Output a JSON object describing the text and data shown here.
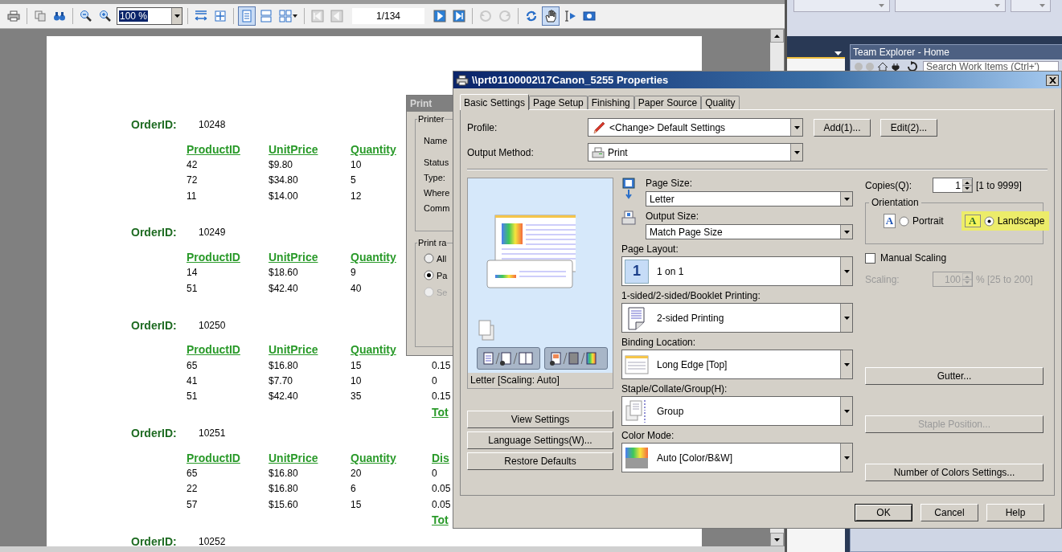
{
  "report_viewer": {
    "toolbar": [
      {
        "kind": "print",
        "pressed": false,
        "disabled": false
      },
      {
        "kind": "sep"
      },
      {
        "kind": "copy",
        "pressed": false,
        "disabled": false
      },
      {
        "kind": "find",
        "pressed": false,
        "disabled": false
      },
      {
        "kind": "sep"
      },
      {
        "kind": "zoom_out",
        "pressed": false,
        "disabled": false
      },
      {
        "kind": "zoom_in",
        "pressed": false,
        "disabled": false
      },
      {
        "kind": "zoom_field",
        "value": "100 %"
      },
      {
        "kind": "sep"
      },
      {
        "kind": "page_width",
        "pressed": false,
        "disabled": false
      },
      {
        "kind": "whole_page",
        "pressed": false,
        "disabled": false
      },
      {
        "kind": "sep"
      },
      {
        "kind": "single_page",
        "pressed": true,
        "disabled": false
      },
      {
        "kind": "continuous",
        "pressed": false,
        "disabled": false
      },
      {
        "kind": "multi_page",
        "pressed": false,
        "disabled": false
      },
      {
        "kind": "sep"
      },
      {
        "kind": "first",
        "pressed": false,
        "disabled": true
      },
      {
        "kind": "prev",
        "pressed": false,
        "disabled": true
      },
      {
        "kind": "page_field",
        "value": "1/134"
      },
      {
        "kind": "next",
        "pressed": false,
        "disabled": false
      },
      {
        "kind": "last",
        "pressed": false,
        "disabled": false
      },
      {
        "kind": "sep"
      },
      {
        "kind": "back",
        "pressed": false,
        "disabled": true
      },
      {
        "kind": "forward",
        "pressed": false,
        "disabled": true
      },
      {
        "kind": "sep"
      },
      {
        "kind": "refresh",
        "pressed": false,
        "disabled": false
      },
      {
        "kind": "hand",
        "pressed": true,
        "disabled": false
      },
      {
        "kind": "select",
        "pressed": false,
        "disabled": false
      },
      {
        "kind": "snapshot",
        "pressed": false,
        "disabled": false
      }
    ],
    "orders": [
      {
        "label": "OrderID:",
        "id": "10248",
        "headers": [
          "ProductID",
          "UnitPrice",
          "Quantity"
        ],
        "rows": [
          [
            "42",
            "$9.80",
            "10"
          ],
          [
            "72",
            "$34.80",
            "5"
          ],
          [
            "11",
            "$14.00",
            "12"
          ]
        ]
      },
      {
        "label": "OrderID:",
        "id": "10249",
        "headers": [
          "ProductID",
          "UnitPrice",
          "Quantity"
        ],
        "rows": [
          [
            "14",
            "$18.60",
            "9"
          ],
          [
            "51",
            "$42.40",
            "40"
          ]
        ]
      },
      {
        "label": "OrderID:",
        "id": "10250",
        "headers": [
          "ProductID",
          "UnitPrice",
          "Quantity"
        ],
        "rows": [
          [
            "65",
            "$16.80",
            "15",
            "0.15"
          ],
          [
            "41",
            "$7.70",
            "10",
            "0"
          ],
          [
            "51",
            "$42.40",
            "35",
            "0.15"
          ]
        ],
        "total": "Tot"
      },
      {
        "label": "OrderID:",
        "id": "10251",
        "headers": [
          "ProductID",
          "UnitPrice",
          "Quantity",
          "Dis"
        ],
        "rows": [
          [
            "65",
            "$16.80",
            "20",
            "0"
          ],
          [
            "22",
            "$16.80",
            "6",
            "0.05"
          ],
          [
            "57",
            "$15.60",
            "15",
            "0.05"
          ]
        ],
        "total": "Tot"
      },
      {
        "label": "OrderID:",
        "id": "10252"
      }
    ]
  },
  "team_explorer": {
    "title": "Team Explorer - Home",
    "search": {
      "placeholder": "Search Work Items (Ctrl+')"
    }
  },
  "print_dialog": {
    "title": "Print",
    "printer_group": {
      "label": "Printer",
      "fields": [
        "Name",
        "Status",
        "Type:",
        "Where",
        "Comm"
      ]
    },
    "range_group": {
      "label": "Print ra",
      "options": [
        {
          "label": "All",
          "selected": false,
          "disabled": false
        },
        {
          "label": "Pa",
          "selected": true,
          "disabled": false
        },
        {
          "label": "Se",
          "selected": false,
          "disabled": true
        }
      ]
    }
  },
  "properties_dialog": {
    "title": "\\\\prt01100002\\17Canon_5255 Properties",
    "tabs": [
      {
        "label": "Basic Settings",
        "selected": true
      },
      {
        "label": "Page Setup",
        "selected": false
      },
      {
        "label": "Finishing",
        "selected": false
      },
      {
        "label": "Paper Source",
        "selected": false
      },
      {
        "label": "Quality",
        "selected": false
      }
    ],
    "profile": {
      "label": "Profile:",
      "value": "<Change> Default Settings"
    },
    "profile_buttons": [
      "Add(1)...",
      "Edit(2)..."
    ],
    "output_method": {
      "label": "Output Method:",
      "value": "Print"
    },
    "preview": {
      "caption": "Letter [Scaling: Auto]"
    },
    "left_buttons": [
      "View Settings",
      "Language Settings(W)...",
      "Restore Defaults"
    ],
    "page_size": {
      "label": "Page Size:",
      "value": "Letter"
    },
    "output_size": {
      "label": "Output Size:",
      "value": "Match Page Size"
    },
    "settings": [
      {
        "kind": "layout",
        "label": "Page Layout:",
        "value": "1 on 1",
        "badge": "1"
      },
      {
        "kind": "duplex",
        "label": "1-sided/2-sided/Booklet Printing:",
        "value": "2-sided Printing"
      },
      {
        "kind": "binding",
        "label": "Binding Location:",
        "value": "Long Edge [Top]"
      },
      {
        "kind": "staple",
        "label": "Staple/Collate/Group(H):",
        "value": "Group"
      },
      {
        "kind": "color",
        "label": "Color Mode:",
        "value": "Auto [Color/B&W]"
      }
    ],
    "copies": {
      "label": "Copies(Q):",
      "value": "1",
      "range": "[1 to 9999]"
    },
    "orientation": {
      "label": "Orientation",
      "options": [
        {
          "label": "Portrait",
          "letter": "A",
          "selected": false
        },
        {
          "label": "Landscape",
          "letter": "A",
          "selected": true
        }
      ]
    },
    "manual_scaling": {
      "label": "Manual Scaling",
      "checked": false
    },
    "scaling": {
      "label": "Scaling:",
      "value": "100",
      "range": "% [25 to 200]",
      "disabled": true
    },
    "right_buttons": [
      {
        "label": "Gutter...",
        "disabled": false
      },
      {
        "label": "Staple Position...",
        "disabled": true
      },
      {
        "label": "Number of Colors Settings...",
        "disabled": false
      }
    ],
    "footer_buttons": [
      "OK",
      "Cancel",
      "Help"
    ]
  }
}
